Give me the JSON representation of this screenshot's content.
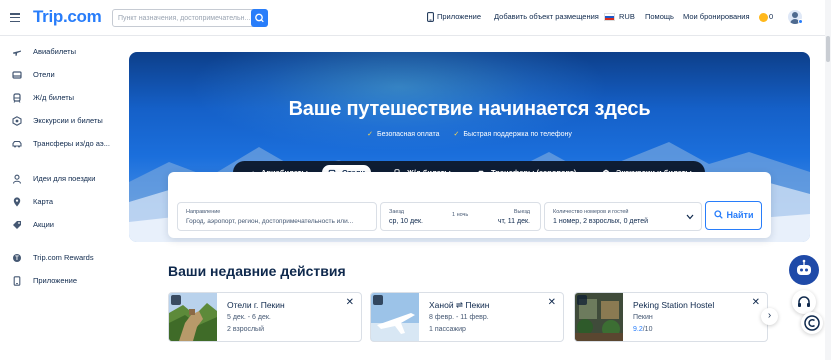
{
  "header": {
    "logo": "Trip.com",
    "search_placeholder": "Пункт назначения, достопримечательн...",
    "nav": {
      "app": "Приложение",
      "add_listing": "Добавить объект размещения",
      "currency": "RUB",
      "help": "Помощь",
      "bookings": "Мои бронирования",
      "coins": "0"
    }
  },
  "sidebar": {
    "items": [
      {
        "label": "Авиабилеты",
        "icon": "plane-icon"
      },
      {
        "label": "Отели",
        "icon": "bed-icon"
      },
      {
        "label": "Ж/д билеты",
        "icon": "train-icon"
      },
      {
        "label": "Экскурсии и билеты",
        "icon": "ticket-icon"
      },
      {
        "label": "Трансферы из/до аэ...",
        "icon": "car-icon"
      },
      {
        "label": "Идеи для поездки",
        "icon": "ideas-icon"
      },
      {
        "label": "Карта",
        "icon": "map-icon"
      },
      {
        "label": "Акции",
        "icon": "tag-icon"
      },
      {
        "label": "Trip.com Rewards",
        "icon": "rewards-icon"
      },
      {
        "label": "Приложение",
        "icon": "phone-icon"
      }
    ]
  },
  "hero": {
    "title": "Ваше путешествие начинается здесь",
    "badge_1": "Безопасная оплата",
    "badge_2": "Быстрая поддержка по телефону"
  },
  "tabs": [
    {
      "label": "Авиабилеты"
    },
    {
      "label": "Отели"
    },
    {
      "label": "Ж/д билеты"
    },
    {
      "label": "Трансферы (аэропорт)"
    },
    {
      "label": "Экскурсии и билеты"
    }
  ],
  "search_form": {
    "destination_label": "Направление",
    "destination_placeholder": "Город, аэропорт, регион, достопримечательность или...",
    "checkin_label": "Заезд",
    "checkin_value": "ср, 10 дек.",
    "nights": "1 ночь",
    "checkout_label": "Выезд",
    "checkout_value": "чт, 11 дек.",
    "rooms_label": "Количество номеров и гостей",
    "rooms_value": "1 номер, 2 взрослых, 0 детей",
    "find_label": "Найти"
  },
  "recent": {
    "title": "Ваши недавние действия",
    "items": [
      {
        "title": "Отели г. Пекин",
        "line1": "5 дек. - 6 дек.",
        "line2": "2 взрослый"
      },
      {
        "title": "Ханой ⇌ Пекин",
        "line1": "8 февр. - 11 февр.",
        "line2": "1 пассажир"
      },
      {
        "title": "Peking Station Hostel",
        "line1": "Пекин",
        "rating": "9.2",
        "rating_suffix": "/10"
      }
    ]
  },
  "colors": {
    "brand": "#287dfa",
    "text": "#0f294d",
    "tabs_bg": "#0e1d33"
  }
}
